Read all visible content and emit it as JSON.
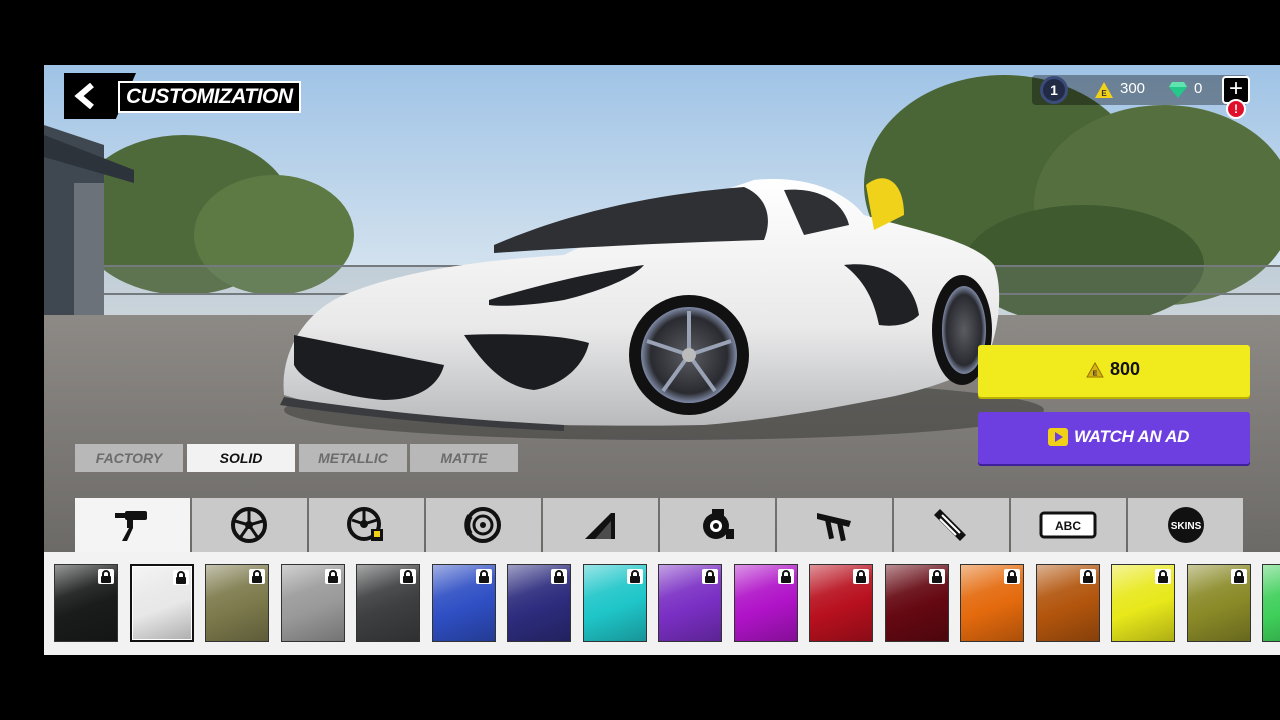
{
  "header": {
    "title": "CUSTOMIZATION"
  },
  "currency": {
    "level": "1",
    "coins": "300",
    "gems": "0",
    "add_symbol": "+",
    "alert": "!"
  },
  "buy": {
    "price": "800",
    "ad_label": "WATCH AN AD"
  },
  "paint_tabs": [
    {
      "label": "FACTORY",
      "active": false
    },
    {
      "label": "SOLID",
      "active": true
    },
    {
      "label": "METALLIC",
      "active": false
    },
    {
      "label": "MATTE",
      "active": false
    }
  ],
  "categories": [
    {
      "name": "paint-icon",
      "label": "",
      "active": true
    },
    {
      "name": "rim-icon",
      "label": "",
      "active": false
    },
    {
      "name": "rim-paint-icon",
      "label": "",
      "active": false
    },
    {
      "name": "brake-icon",
      "label": "",
      "active": false
    },
    {
      "name": "window-tint-icon",
      "label": "",
      "active": false
    },
    {
      "name": "turbo-icon",
      "label": "",
      "active": false
    },
    {
      "name": "spoiler-icon",
      "label": "",
      "active": false
    },
    {
      "name": "vinyl-icon",
      "label": "",
      "active": false
    },
    {
      "name": "license-plate-icon",
      "label": "ABC",
      "active": false
    },
    {
      "name": "skins-icon",
      "label": "SKINS",
      "active": false
    }
  ],
  "swatches": [
    {
      "color": "#1a1c1c",
      "locked": true,
      "selected": false
    },
    {
      "color": "#e8e8e8",
      "locked": true,
      "selected": true
    },
    {
      "color": "#7d7a4c",
      "locked": true,
      "selected": false
    },
    {
      "color": "#9a9a9a",
      "locked": true,
      "selected": false
    },
    {
      "color": "#3e3f40",
      "locked": true,
      "selected": false
    },
    {
      "color": "#2f4fc4",
      "locked": true,
      "selected": false
    },
    {
      "color": "#2d2c7e",
      "locked": true,
      "selected": false
    },
    {
      "color": "#1fc6c9",
      "locked": true,
      "selected": false
    },
    {
      "color": "#7a2fc4",
      "locked": true,
      "selected": false
    },
    {
      "color": "#b013c8",
      "locked": true,
      "selected": false
    },
    {
      "color": "#b8101e",
      "locked": true,
      "selected": false
    },
    {
      "color": "#650812",
      "locked": true,
      "selected": false
    },
    {
      "color": "#e46a0d",
      "locked": true,
      "selected": false
    },
    {
      "color": "#b2550d",
      "locked": true,
      "selected": false
    },
    {
      "color": "#e8e81b",
      "locked": true,
      "selected": false
    },
    {
      "color": "#8a8a28",
      "locked": true,
      "selected": false
    },
    {
      "color": "#3fcf5a",
      "locked": false,
      "selected": false
    }
  ],
  "colors": {
    "price_button": "#f1ea1c",
    "ad_button": "#6d3fe0"
  }
}
